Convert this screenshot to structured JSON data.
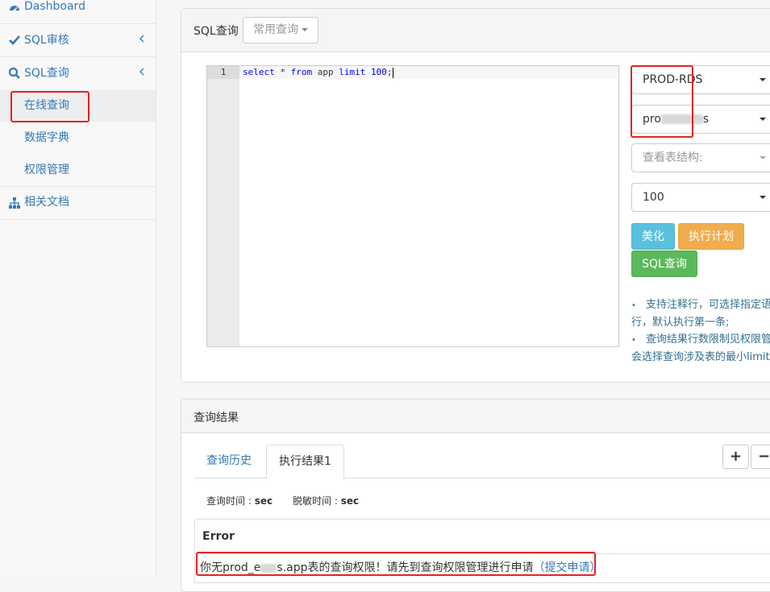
{
  "sidebar": {
    "items": [
      {
        "label": "Dashboard",
        "icon": "dashboard-icon"
      },
      {
        "label": "SQL审核",
        "icon": "check-icon"
      },
      {
        "label": "SQL查询",
        "icon": "search-icon"
      },
      {
        "label": "相关文档",
        "icon": "sitemap-icon"
      }
    ],
    "sub_items": [
      {
        "label": "在线查询",
        "active": true
      },
      {
        "label": "数据字典"
      },
      {
        "label": "权限管理"
      }
    ]
  },
  "query_panel": {
    "title": "SQL查询",
    "common_query_label": "常用查询",
    "editor": {
      "line_number": "1",
      "code": {
        "kw_select": "select",
        "star": " * ",
        "kw_from": "from",
        "table": " app ",
        "kw_limit": "limit",
        "space": " ",
        "limit_value": "100",
        "semicolon": ";"
      }
    },
    "instance_select": "PROD-RDS",
    "database_select": {
      "prefix": "pro",
      "suffix": "s"
    },
    "table_structure_placeholder": "查看表结构:",
    "limit_select": "100",
    "buttons": {
      "beautify": "美化",
      "explain": "执行计划",
      "query": "SQL查询"
    },
    "tips": [
      "支持注释行，可选择指定语句执行，默认执行第一条;",
      "查询结果行数限制见权限管理，会选择查询涉及表的最小limit值"
    ]
  },
  "results_panel": {
    "title": "查询结果",
    "tabs": [
      {
        "label": "查询历史",
        "active": false
      },
      {
        "label": "执行结果1",
        "active": true
      }
    ],
    "plus_label": "+",
    "minus_label": "−",
    "query_time_label": "查询时间 : ",
    "query_time_value": "sec",
    "mask_time_label": "脱敏时间 : ",
    "mask_time_value": "sec",
    "error_title": "Error",
    "error_message_prefix": "你无prod_e",
    "error_message_suffix": "s.app表的查询权限！请先到查询权限管理进行申请",
    "error_link": "（提交申请）"
  },
  "colors": {
    "link": "#337ab7",
    "highlight_box": "#e32424",
    "info": "#5bc0de",
    "warning": "#f0ad4e",
    "success": "#5cb85c"
  }
}
